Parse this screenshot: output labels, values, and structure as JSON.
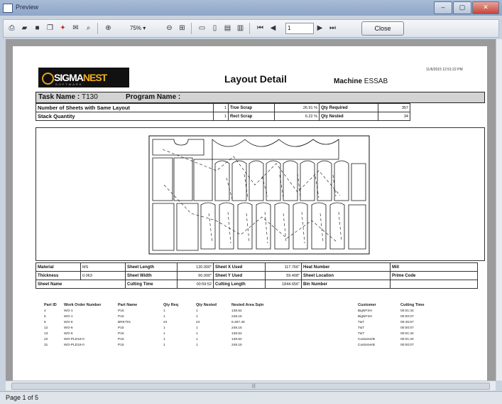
{
  "window": {
    "title": "Preview",
    "controls": [
      "–",
      "▢",
      "✕"
    ]
  },
  "toolbar": {
    "zoom": "75%",
    "page_value": "1",
    "close_label": "Close"
  },
  "status": {
    "page_text": "Page 1 of 5"
  },
  "report": {
    "title": "Layout Detail",
    "machine_label": "Machine",
    "machine_value": "ESSAB",
    "timestamp": "11/6/2015 12:51:22 PM",
    "logo": {
      "text_a": "SIGMA",
      "text_b": "NEST",
      "tagline": "SOFTWARE"
    },
    "task_label": "Task Name :",
    "task_value": "T130",
    "program_label": "Program Name :",
    "same_layout_label": "Number of Sheets with Same Layout",
    "same_layout_value": "1",
    "stack_label": "Stack Quantity",
    "stack_value": "1",
    "true_scrap_label": "True Scrap",
    "true_scrap_value": "26.91 %",
    "rect_scrap_label": "Rect Scrap",
    "rect_scrap_value": "6.22 %",
    "qty_required_label": "Qty Required",
    "qty_required_value": "357",
    "qty_nested_label": "Qty Nested",
    "qty_nested_value": "34"
  },
  "specs": {
    "material_label": "Material",
    "material_value": "MS",
    "thickness_label": "Thickness",
    "thickness_value": "0.063",
    "sheetname_label": "Sheet Name",
    "sheet_length_label": "Sheet Length",
    "sheet_length_value": "120.000\"",
    "sheet_width_label": "Sheet Width",
    "sheet_width_value": "60.000\"",
    "cutting_time_label": "Cutting Time",
    "cutting_time_value": "00:59:52",
    "x_used_label": "Sheet X Used",
    "x_used_value": "117.766\"",
    "y_used_label": "Sheet Y Used",
    "y_used_value": "59.408\"",
    "cut_length_label": "Cutting Length",
    "cut_length_value": "1844.656\"",
    "heat_label": "Heat Number",
    "location_label": "Sheet Location",
    "bin_label": "Bin Number",
    "mill_label": "Mill",
    "prime_label": "Prime Code"
  },
  "parts": {
    "headers": [
      "Part ID",
      "Work Order Number",
      "Part Name",
      "Qty Req",
      "Qty Nested",
      "Nested Area Sqin",
      "Customer",
      "Cutting Time"
    ],
    "rows": [
      [
        "4",
        "WO-1",
        "P16",
        "1",
        "1",
        "138.52",
        "BigNFSH",
        "00:01:34"
      ],
      [
        "5",
        "WO-1",
        "P16",
        "1",
        "1",
        "248.15",
        "BigNFSH",
        "00:00:07"
      ],
      [
        "6",
        "WO-6",
        "BRKT01",
        "24",
        "24",
        "6.487.46",
        "T&T",
        "00:45:57"
      ],
      [
        "12",
        "WO-6",
        "P15",
        "1",
        "1",
        "248.15",
        "T&T",
        "00:00:07"
      ],
      [
        "13",
        "WO-6",
        "P16",
        "1",
        "1",
        "138.52",
        "T&T",
        "00:01:34"
      ],
      [
        "22",
        "WO-PLD16-0",
        "P16",
        "1",
        "1",
        "138.52",
        "CustomerB",
        "00:01:34"
      ],
      [
        "31",
        "WO-PLD16-0",
        "P15",
        "1",
        "1",
        "248.15",
        "CustomerB",
        "00:00:07"
      ]
    ]
  },
  "colors": {
    "logo_bg": "#111111",
    "logo_accent": "#f2b01e",
    "close_red": "#c7463a"
  }
}
